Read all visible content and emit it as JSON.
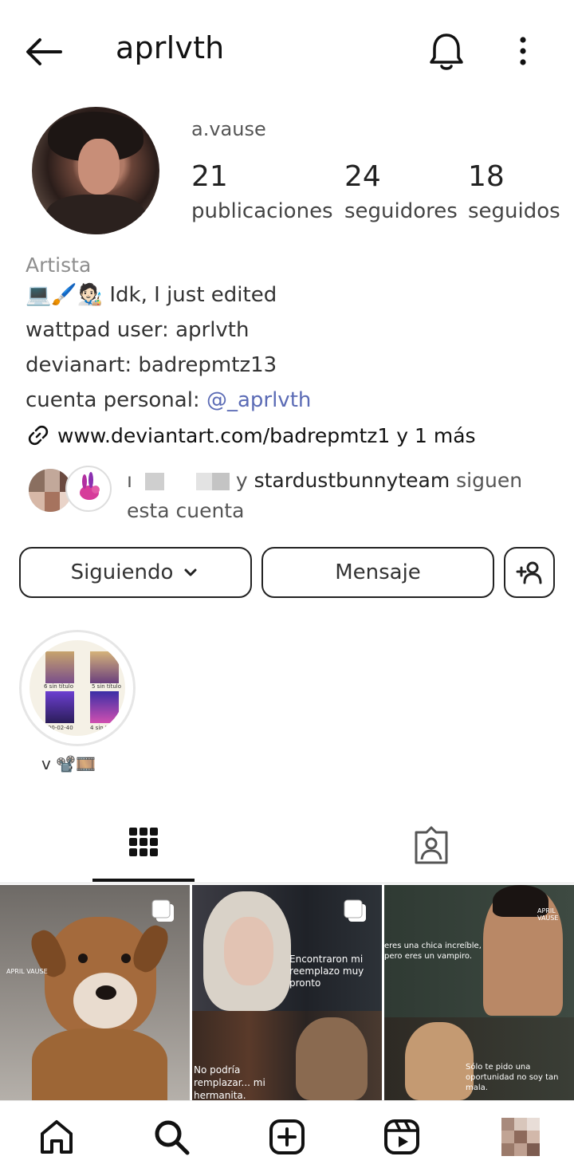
{
  "header": {
    "username": "aprlvth",
    "back_icon": "arrow-left-icon",
    "notification_icon": "bell-icon",
    "menu_icon": "more-vertical-icon"
  },
  "profile": {
    "display_name": "a.vause",
    "stats": [
      {
        "value": "21",
        "label": "publicaciones"
      },
      {
        "value": "24",
        "label": "seguidores"
      },
      {
        "value": "18",
        "label": "seguidos"
      }
    ]
  },
  "bio": {
    "category": "Artista",
    "line1_emoji": "💻🖌️🧑🏻‍🎨",
    "line1_text": " Idk, I just edited",
    "line2": "wattpad user: aprlvth",
    "line3": "devianart:  badrepmtz13",
    "line4_prefix": "cuenta personal: ",
    "line4_mention": "@_aprlvth",
    "link_text": "www.deviantart.com/badrepmtz1 y 1 más"
  },
  "followed_by": {
    "prefix": "ı",
    "joiner": " y ",
    "account": "stardustbunnyteam",
    "suffix": " siguen esta cuenta"
  },
  "actions": {
    "following_label": "Siguiendo",
    "message_label": "Mensaje",
    "add_user_icon": "add-person-icon"
  },
  "highlight": {
    "caption": "v 📽️🎞️",
    "tile_labels": [
      "6 sin título",
      "5 sin título",
      "2000-02-40",
      "4 sin título"
    ]
  },
  "tabs": {
    "grid_icon": "grid-icon",
    "tagged_icon": "tagged-person-icon"
  },
  "posts": [
    {
      "overlay_text": "",
      "watermark": "APRIL VAUSE",
      "multi": true
    },
    {
      "overlay_text": "Encontraron mi reemplazo muy pronto",
      "overlay_text2": "No podría remplazar... mi hermanita.",
      "multi": true
    },
    {
      "overlay_text": "eres una chica increíble, pero eres un vampiro.",
      "overlay_text2": "Sólo te pido una oportunidad no soy tan mala.",
      "watermark": "APRIL VAUSE",
      "multi": false
    }
  ],
  "bottom_nav": [
    "home-icon",
    "search-icon",
    "create-icon",
    "reels-icon",
    "profile-icon"
  ],
  "colors": {
    "text": "#262626",
    "muted": "#8e8e8e",
    "mention": "#5b6bb5",
    "border": "#222222"
  }
}
